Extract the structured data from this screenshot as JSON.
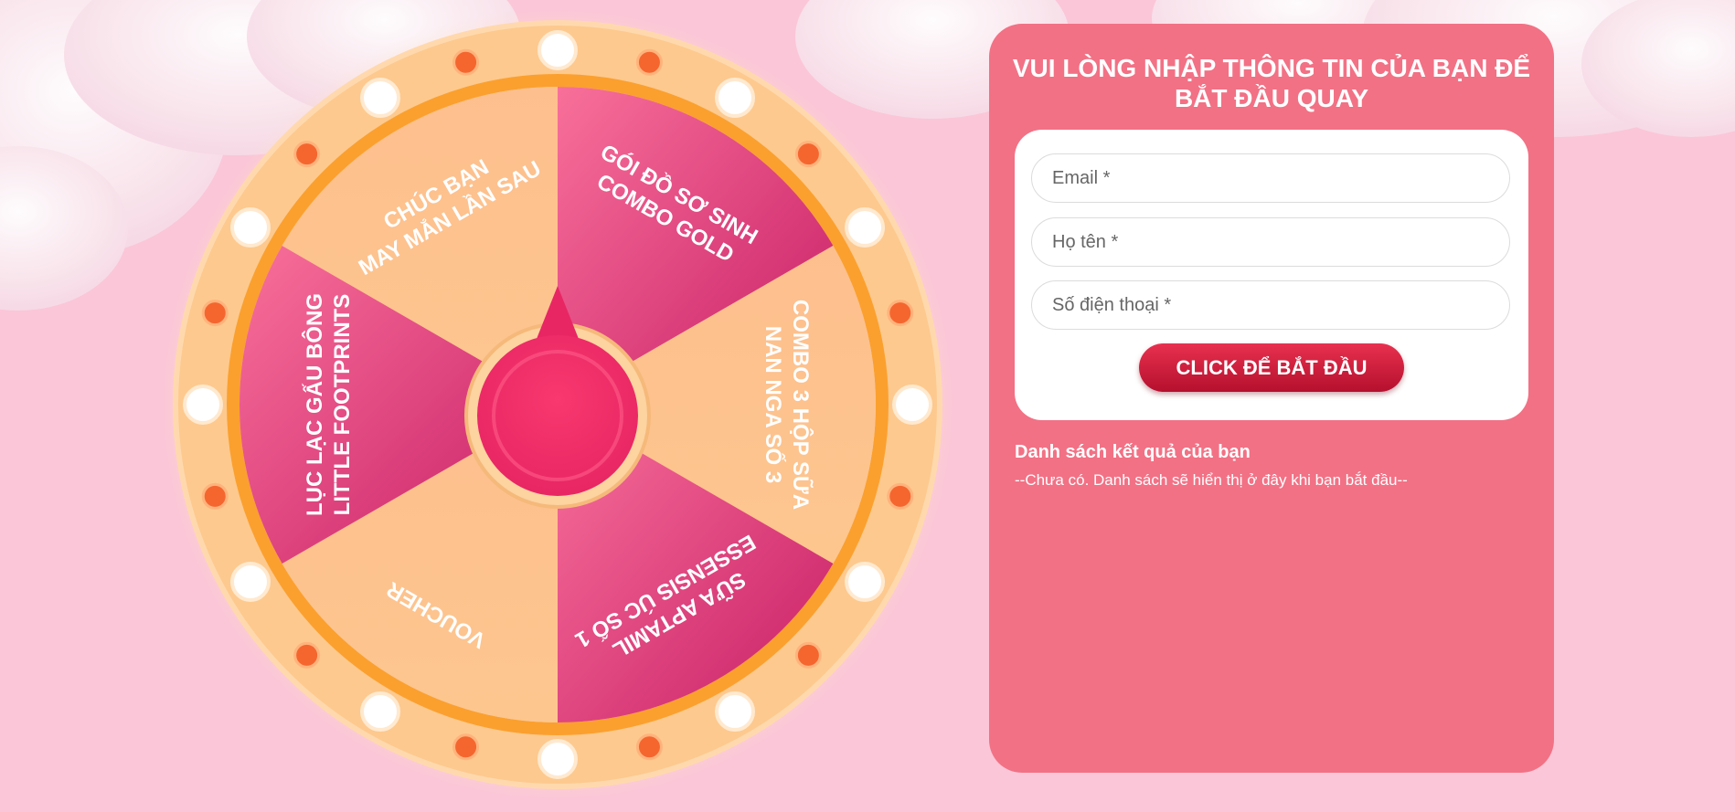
{
  "wheel": {
    "prizes": [
      "GÓI ĐỒ SƠ SINH COMBO GOLD",
      "COMBO 3 HỘP SỮA NAN NGA SỐ 3",
      "SỮA APTAMIL ESSENSIS ÚC SỐ 1",
      "VOUCHER",
      "LỤC LẠC GẤU BÔNG LITTLE FOOTPRINTS",
      "CHÚC BẠN MAY MẮN LẦN SAU"
    ],
    "prize_lines": [
      [
        "GÓI ĐỒ SƠ SINH",
        "COMBO GOLD"
      ],
      [
        "COMBO 3 HỘP SỮA",
        "NAN NGA SỐ 3"
      ],
      [
        "SỮA APTAMIL",
        "ESSENSIS ÚC SỐ 1"
      ],
      [
        "VOUCHER"
      ],
      [
        "LỤC LẠC GẤU BÔNG",
        "LITTLE FOOTPRINTS"
      ],
      [
        "CHÚC BẠN",
        "MAY MẮN LẦN SAU"
      ]
    ],
    "colors": {
      "pink_segment": "#e3487c",
      "peach_segment": "#fdbd8b",
      "rim": "#fdc98e",
      "ring": "#fba02e",
      "hub": "#f0336b"
    }
  },
  "form": {
    "title": "VUI LÒNG NHẬP THÔNG TIN CỦA BẠN ĐỂ BẮT ĐẦU QUAY",
    "email_placeholder": "Email *",
    "name_placeholder": "Họ tên *",
    "phone_placeholder": "Số điện thoại *",
    "submit_label": "CLICK ĐỂ BẮT ĐẦU"
  },
  "results": {
    "title": "Danh sách kết quả của bạn",
    "empty_text": "--Chưa có. Danh sách sẽ hiển thị ở đây khi bạn bắt đầu--"
  },
  "colors": {
    "page_bg": "#fbc6d8",
    "panel_bg": "#f27185",
    "button": "#d0213f"
  }
}
